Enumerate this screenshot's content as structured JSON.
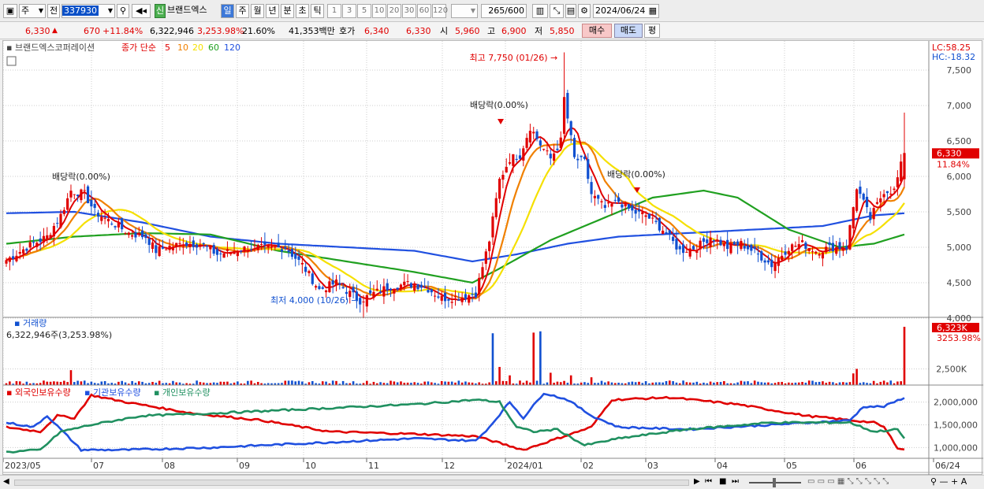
{
  "toolbar": {
    "period_select": "주",
    "prev_label": "전",
    "stock_code": "337930",
    "stock_badge": "신",
    "stock_name": "브랜드엑스",
    "period_tabs": [
      "일",
      "주",
      "월",
      "년",
      "분",
      "초",
      "틱"
    ],
    "active_period": "일",
    "interval_buttons": [
      "1",
      "3",
      "5",
      "10",
      "20",
      "30",
      "60",
      "120"
    ],
    "count_value": "265",
    "count_max": "/600",
    "date_value": "2024/06/24"
  },
  "quote": {
    "price": "6,330",
    "change_arrow": "▲",
    "change": "670",
    "change_pct": "+11.84%",
    "volume": "6,322,946",
    "volume_ratio": "3,253.98%",
    "turnover": "21.60%",
    "amount": "41,353백만",
    "ask_label": "호가",
    "ask_value": "6,340",
    "bid_value": "6,330",
    "open_label": "시",
    "open_value": "5,960",
    "high_label": "고",
    "high_value": "6,900",
    "low_label": "저",
    "low_value": "5,850",
    "buy_button": "매수",
    "sell_button": "매도",
    "eval_button": "평"
  },
  "chart_data": {
    "type": "candlestick",
    "title": "브랜드엑스코퍼레이션",
    "legend_price": "종가 단순",
    "ma_labels": [
      "5",
      "10",
      "20",
      "60",
      "120"
    ],
    "ma_colors": [
      "#e00000",
      "#f08000",
      "#f5e000",
      "#20a020",
      "#2050e0"
    ],
    "lc_label": "LC:58.25",
    "hc_label": "HC:-18.32",
    "current_price_tag": "6,330",
    "current_pct_tag": "11.84%",
    "ylim": [
      3800,
      7800
    ],
    "yticks": [
      4000,
      4500,
      5000,
      5500,
      6000,
      6500,
      7000,
      7500
    ],
    "ytick_labels": [
      "4,000",
      "4,500",
      "5,000",
      "5,500",
      "6,000",
      "6,500",
      "7,000",
      "7,500"
    ],
    "x_labels": [
      "2023/05",
      "07",
      "08",
      "09",
      "10",
      "11",
      "12",
      "2024/01",
      "02",
      "03",
      "04",
      "05",
      "06",
      "06/24"
    ],
    "annotations": {
      "high": "최고 7,750 (01/26)",
      "low": "최저 4,000 (10/26)",
      "dividends": [
        "배당락(0.00%)",
        "배당락(0.00%)",
        "배당락(0.00%)"
      ]
    },
    "close_anchors": [
      [
        0,
        4820
      ],
      [
        6,
        5000
      ],
      [
        12,
        5150
      ],
      [
        16,
        5450
      ],
      [
        19,
        5800
      ],
      [
        23,
        5750
      ],
      [
        26,
        5500
      ],
      [
        31,
        5350
      ],
      [
        36,
        5200
      ],
      [
        41,
        5150
      ],
      [
        44,
        4950
      ],
      [
        47,
        5000
      ],
      [
        52,
        5050
      ],
      [
        57,
        5050
      ],
      [
        62,
        4900
      ],
      [
        67,
        4950
      ],
      [
        72,
        5000
      ],
      [
        77,
        4980
      ],
      [
        82,
        5000
      ],
      [
        87,
        4750
      ],
      [
        92,
        4400
      ],
      [
        97,
        4500
      ],
      [
        101,
        4350
      ],
      [
        104,
        4250
      ],
      [
        108,
        4350
      ],
      [
        113,
        4450
      ],
      [
        118,
        4480
      ],
      [
        123,
        4450
      ],
      [
        128,
        4280
      ],
      [
        134,
        4300
      ],
      [
        138,
        4350
      ],
      [
        142,
        5100
      ],
      [
        145,
        5950
      ],
      [
        148,
        6250
      ],
      [
        151,
        6300
      ],
      [
        154,
        6700
      ],
      [
        157,
        6450
      ],
      [
        160,
        6250
      ],
      [
        163,
        6500
      ],
      [
        164,
        7100
      ],
      [
        167,
        6250
      ],
      [
        170,
        6200
      ],
      [
        172,
        5750
      ],
      [
        176,
        5550
      ],
      [
        180,
        5650
      ],
      [
        184,
        5500
      ],
      [
        188,
        5450
      ],
      [
        193,
        5250
      ],
      [
        198,
        4950
      ],
      [
        203,
        5000
      ],
      [
        207,
        5150
      ],
      [
        212,
        5000
      ],
      [
        216,
        5050
      ],
      [
        221,
        4900
      ],
      [
        225,
        4750
      ],
      [
        230,
        5000
      ],
      [
        234,
        5050
      ],
      [
        238,
        4950
      ],
      [
        243,
        5000
      ],
      [
        247,
        5000
      ],
      [
        250,
        5850
      ],
      [
        254,
        5400
      ],
      [
        258,
        5800
      ],
      [
        261,
        5800
      ],
      [
        264,
        6330
      ]
    ],
    "ma60_anchors": [
      [
        0,
        5050
      ],
      [
        20,
        5150
      ],
      [
        40,
        5200
      ],
      [
        60,
        5180
      ],
      [
        80,
        4950
      ],
      [
        100,
        4800
      ],
      [
        120,
        4650
      ],
      [
        137,
        4500
      ],
      [
        145,
        4700
      ],
      [
        160,
        5100
      ],
      [
        175,
        5400
      ],
      [
        190,
        5700
      ],
      [
        205,
        5800
      ],
      [
        215,
        5700
      ],
      [
        230,
        5250
      ],
      [
        245,
        5000
      ],
      [
        255,
        5050
      ],
      [
        264,
        5180
      ]
    ],
    "ma120_anchors": [
      [
        0,
        5480
      ],
      [
        20,
        5500
      ],
      [
        40,
        5350
      ],
      [
        60,
        5150
      ],
      [
        80,
        5050
      ],
      [
        100,
        5000
      ],
      [
        120,
        4950
      ],
      [
        137,
        4800
      ],
      [
        150,
        4900
      ],
      [
        165,
        5050
      ],
      [
        180,
        5150
      ],
      [
        200,
        5200
      ],
      [
        220,
        5250
      ],
      [
        240,
        5300
      ],
      [
        255,
        5450
      ],
      [
        264,
        5480
      ]
    ],
    "volume": {
      "label": "거래량",
      "value_label": "6,322,946주(3,253.98%)",
      "current_tag": "6,323K",
      "pct_tag": "3253.98%",
      "ytick_label": "2,500K",
      "ylim": [
        0,
        9000
      ],
      "spikes": [
        [
          19,
          2300,
          "up"
        ],
        [
          143,
          8000,
          "down"
        ],
        [
          145,
          2800,
          "up"
        ],
        [
          148,
          1500,
          "up"
        ],
        [
          155,
          8100,
          "up"
        ],
        [
          157,
          8300,
          "down"
        ],
        [
          160,
          1900,
          "up"
        ],
        [
          166,
          1500,
          "up"
        ],
        [
          172,
          1200,
          "up"
        ],
        [
          249,
          1800,
          "up"
        ],
        [
          250,
          2500,
          "up"
        ],
        [
          264,
          9000,
          "up"
        ]
      ]
    },
    "holdings": {
      "legend": [
        "외국인보유수량",
        "기관보유수량",
        "개인보유수량"
      ],
      "colors": [
        "#e00000",
        "#2050e0",
        "#209060"
      ],
      "ytick_labels": [
        "2,000,000",
        "1,500,000",
        "1,000,000"
      ],
      "ylim": [
        800000,
        2200000
      ],
      "foreign_anchors": [
        [
          0,
          1450000
        ],
        [
          10,
          1350000
        ],
        [
          15,
          1700000
        ],
        [
          20,
          1650000
        ],
        [
          25,
          2150000
        ],
        [
          35,
          2000000
        ],
        [
          55,
          1750000
        ],
        [
          75,
          1600000
        ],
        [
          95,
          1350000
        ],
        [
          120,
          1300000
        ],
        [
          138,
          1250000
        ],
        [
          145,
          1100000
        ],
        [
          152,
          950000
        ],
        [
          162,
          1200000
        ],
        [
          172,
          1450000
        ],
        [
          178,
          2050000
        ],
        [
          195,
          2100000
        ],
        [
          215,
          1950000
        ],
        [
          235,
          1700000
        ],
        [
          255,
          1550000
        ],
        [
          258,
          1450000
        ],
        [
          262,
          1000000
        ],
        [
          264,
          950000
        ]
      ],
      "inst_anchors": [
        [
          0,
          1550000
        ],
        [
          8,
          1450000
        ],
        [
          12,
          1700000
        ],
        [
          16,
          1400000
        ],
        [
          22,
          950000
        ],
        [
          35,
          950000
        ],
        [
          60,
          1000000
        ],
        [
          90,
          1100000
        ],
        [
          120,
          1200000
        ],
        [
          138,
          1150000
        ],
        [
          142,
          1450000
        ],
        [
          148,
          2000000
        ],
        [
          152,
          1650000
        ],
        [
          158,
          2200000
        ],
        [
          165,
          2050000
        ],
        [
          172,
          1700000
        ],
        [
          180,
          1450000
        ],
        [
          200,
          1400000
        ],
        [
          225,
          1500000
        ],
        [
          248,
          1600000
        ],
        [
          252,
          1900000
        ],
        [
          258,
          1900000
        ],
        [
          264,
          2100000
        ]
      ],
      "indiv_anchors": [
        [
          0,
          900000
        ],
        [
          10,
          950000
        ],
        [
          16,
          1350000
        ],
        [
          25,
          1500000
        ],
        [
          40,
          1700000
        ],
        [
          60,
          1750000
        ],
        [
          90,
          1850000
        ],
        [
          120,
          1950000
        ],
        [
          138,
          2050000
        ],
        [
          145,
          2000000
        ],
        [
          150,
          1450000
        ],
        [
          155,
          1350000
        ],
        [
          162,
          1400000
        ],
        [
          170,
          1050000
        ],
        [
          180,
          1200000
        ],
        [
          200,
          1400000
        ],
        [
          225,
          1550000
        ],
        [
          248,
          1550000
        ],
        [
          255,
          1350000
        ],
        [
          262,
          1400000
        ],
        [
          264,
          1200000
        ]
      ]
    }
  }
}
